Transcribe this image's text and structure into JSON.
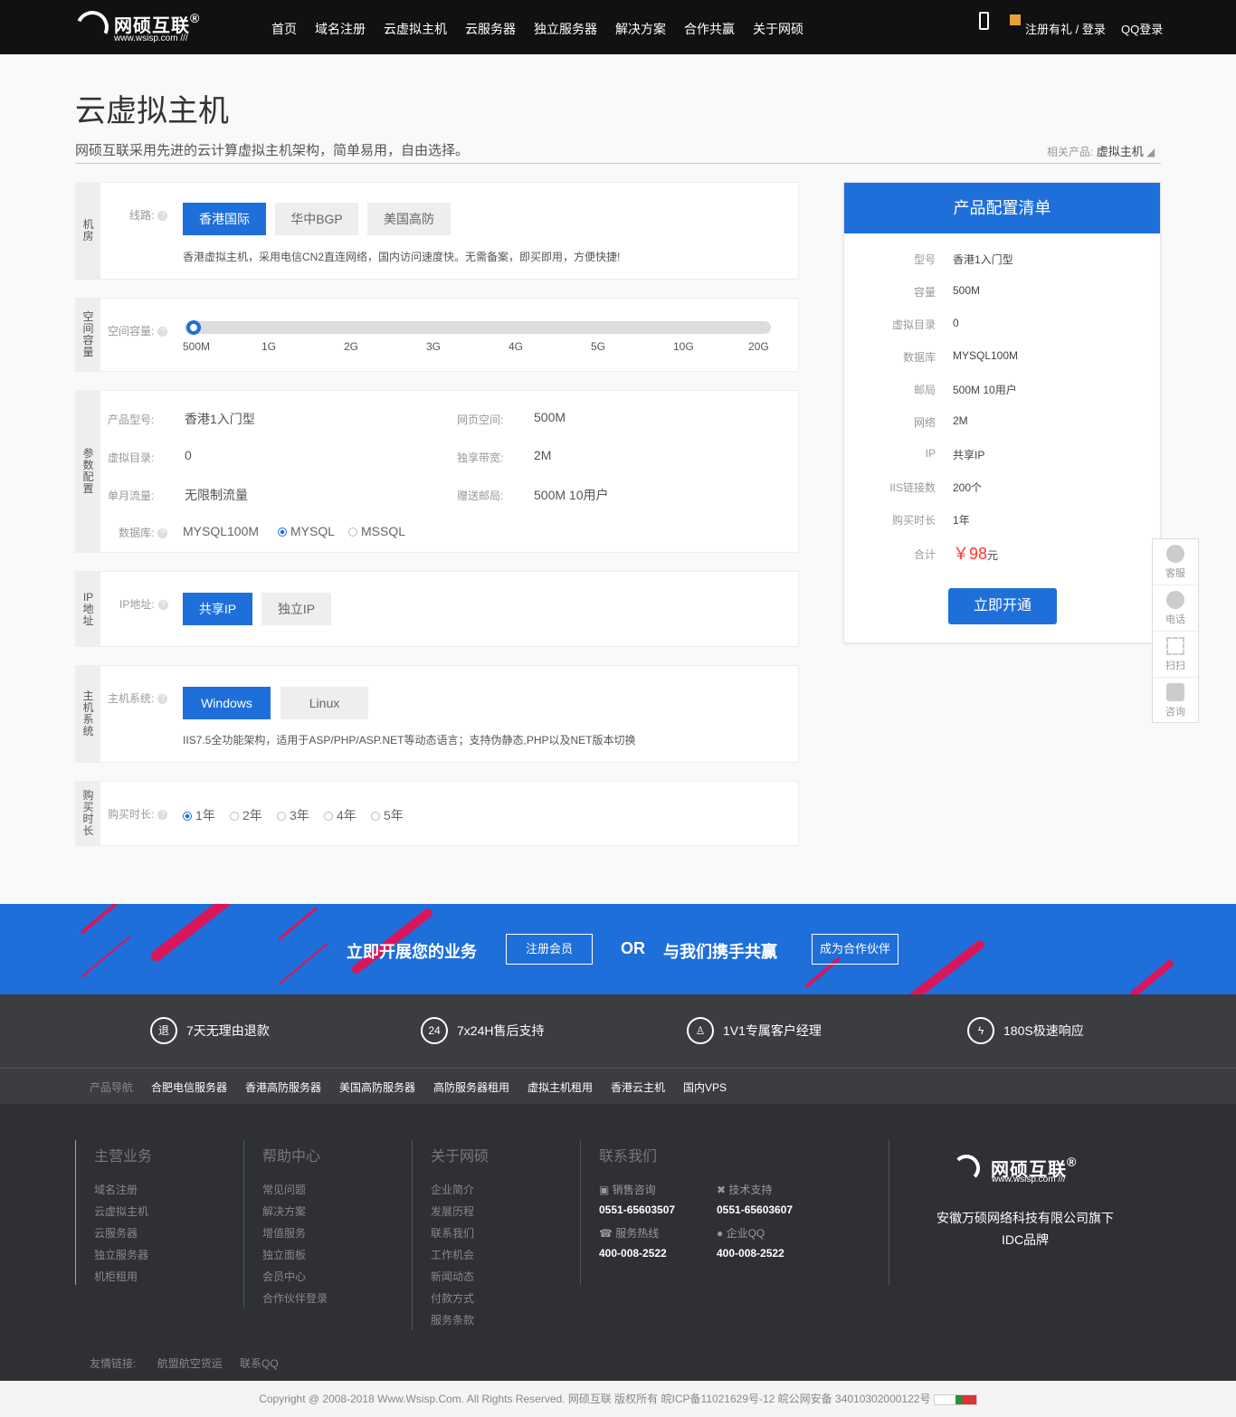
{
  "header": {
    "brand": "网硕互联",
    "brand_mark": "®",
    "brand_sub": "www.wsisp.com ///",
    "nav": [
      "首页",
      "域名注册",
      "云虚拟主机",
      "云服务器",
      "独立服务器",
      "解决方案",
      "合作共赢",
      "关于网硕"
    ],
    "register": "注册有礼 / 登录",
    "qq_login": "QQ登录"
  },
  "page": {
    "title": "云虚拟主机",
    "subtitle": "网硕互联采用先进的云计算虚拟主机架构，简单易用，自由选择。",
    "related_label": "相关产品:",
    "related_value": "虚拟主机"
  },
  "room": {
    "tab": "机房",
    "label": "线路:",
    "options": [
      "香港国际",
      "华中BGP",
      "美国高防"
    ],
    "selected": 0,
    "desc": "香港虚拟主机，采用电信CN2直连网络，国内访问速度快。无需备案，即买即用，方便快捷!"
  },
  "space": {
    "tab": "空间容量",
    "label": "空间容量:",
    "ticks": [
      "500M",
      "1G",
      "2G",
      "3G",
      "4G",
      "5G",
      "10G",
      "20G"
    ],
    "selected": 0
  },
  "params": {
    "tab": "参数配置",
    "model_label": "产品型号:",
    "model": "香港1入门型",
    "web_label": "网页空间:",
    "web": "500M",
    "vdir_label": "虚拟目录:",
    "vdir": "0",
    "bw_label": "独享带宽:",
    "bw": "2M",
    "traffic_label": "单月流量:",
    "traffic": "无限制流量",
    "mail_label": "赠送邮局:",
    "mail": "500M 10用户",
    "db_label": "数据库:",
    "db_size": "MYSQL100M",
    "db_options": [
      "MYSQL",
      "MSSQL"
    ],
    "db_selected": 0
  },
  "ip": {
    "tab": "IP地址",
    "label": "IP地址:",
    "options": [
      "共享IP",
      "独立IP"
    ],
    "selected": 0
  },
  "os": {
    "tab": "主机系统",
    "label": "主机系统:",
    "options": [
      "Windows",
      "Linux"
    ],
    "selected": 0,
    "desc": "IIS7.5全功能架构，适用于ASP/PHP/ASP.NET等动态语言；支持伪静态,PHP以及NET版本切换"
  },
  "period": {
    "tab": "购买时长",
    "label": "购买时长:",
    "options": [
      "1年",
      "2年",
      "3年",
      "4年",
      "5年"
    ],
    "selected": 0
  },
  "summary": {
    "title": "产品配置清单",
    "rows": [
      {
        "k": "型号",
        "v": "香港1入门型"
      },
      {
        "k": "容量",
        "v": "500M"
      },
      {
        "k": "虚拟目录",
        "v": "0"
      },
      {
        "k": "数据库",
        "v": "MYSQL100M"
      },
      {
        "k": "邮局",
        "v": "500M 10用户"
      },
      {
        "k": "网络",
        "v": "2M"
      },
      {
        "k": "IP",
        "v": "共享IP"
      },
      {
        "k": "IIS链接数",
        "v": "200个"
      },
      {
        "k": "购买时长",
        "v": "1年"
      }
    ],
    "total_label": "合计",
    "price": "￥98",
    "unit": "元",
    "button": "立即开通"
  },
  "side": [
    "客服",
    "电话",
    "扫扫",
    "咨询"
  ],
  "banner": {
    "left": "立即开展您的业务",
    "btn1": "注册会员",
    "or": "OR",
    "right": "与我们携手共赢",
    "btn2": "成为合作伙伴"
  },
  "features": [
    {
      "icon": "退",
      "t": "7天无理由退款"
    },
    {
      "icon": "24",
      "t": "7x24H售后支持"
    },
    {
      "icon": "♙",
      "t": "1V1专属客户经理"
    },
    {
      "icon": "ϟ",
      "t": "180S极速响应"
    }
  ],
  "pnav": {
    "label": "产品导航",
    "items": [
      "合肥电信服务器",
      "香港高防服务器",
      "美国高防服务器",
      "高防服务器租用",
      "虚拟主机租用",
      "香港云主机",
      "国内VPS"
    ]
  },
  "footer": {
    "cols": [
      {
        "h": "主营业务",
        "items": [
          "域名注册",
          "云虚拟主机",
          "云服务器",
          "独立服务器",
          "机柜租用"
        ]
      },
      {
        "h": "帮助中心",
        "items": [
          "常见问题",
          "解决方案",
          "增值服务",
          "独立面板",
          "会员中心",
          "合作伙伴登录"
        ]
      },
      {
        "h": "关于网硕",
        "items": [
          "企业简介",
          "发展历程",
          "联系我们",
          "工作机会",
          "新闻动态",
          "付款方式",
          "服务条款"
        ]
      }
    ],
    "contact": {
      "h": "联系我们",
      "sales": "销售咨询",
      "sales_tel": "0551-65603507",
      "tech": "技术支持",
      "tech_tel": "0551-65603607",
      "hotline": "服务热线",
      "hotline_tel": "400-008-2522",
      "qq": "企业QQ",
      "qq_tel": "400-008-2522"
    },
    "company": "安徽万硕网络科技有限公司旗下",
    "company2": "IDC品牌",
    "links_label": "友情链接:",
    "links": [
      "航盟航空货运",
      "联系QQ"
    ]
  },
  "copyright": "Copyright @ 2008-2018 Www.Wsisp.Com. All Rights Reserved. 网硕互联 版权所有 皖ICP备11021629号-12 皖公网安备 34010302000122号",
  "colors": {
    "accent": "#1e6fd9",
    "price": "#ff3333",
    "stripe": "#d9165a",
    "dark": "#2e3034"
  }
}
